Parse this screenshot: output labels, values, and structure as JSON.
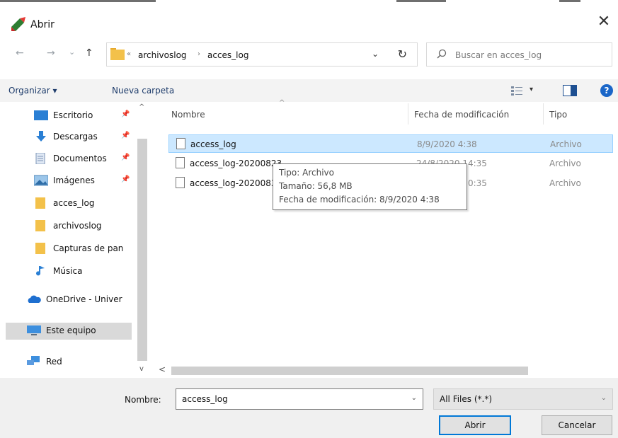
{
  "window": {
    "title": "Abrir"
  },
  "nav_buttons": {
    "back": "←",
    "forward": "→",
    "recent": "⌄",
    "up": "↑"
  },
  "address": {
    "overflow": "«",
    "crumbs": [
      "archivoslog",
      "acces_log"
    ],
    "separator": "›",
    "dropdown": "⌄",
    "refresh": "↻"
  },
  "search": {
    "placeholder": "Buscar en acces_log"
  },
  "toolbar": {
    "organize": "Organizar ▾",
    "new_folder": "Nueva carpeta",
    "view_dropdown": "▾",
    "help": "?"
  },
  "nav_pane": {
    "items": [
      {
        "label": "Escritorio",
        "icon": "desktop-icon",
        "pin": "📌"
      },
      {
        "label": "Descargas",
        "icon": "download-icon",
        "pin": "📌"
      },
      {
        "label": "Documentos",
        "icon": "document-icon",
        "pin": "📌"
      },
      {
        "label": "Imágenes",
        "icon": "pictures-icon",
        "pin": "📌"
      },
      {
        "label": "acces_log",
        "icon": "folder-icon"
      },
      {
        "label": "archivoslog",
        "icon": "folder-icon"
      },
      {
        "label": "Capturas de pan",
        "icon": "folder-icon"
      },
      {
        "label": "Música",
        "icon": "music-icon"
      },
      {
        "label": "OneDrive - Univer",
        "icon": "cloud-icon"
      },
      {
        "label": "Este equipo",
        "icon": "computer-icon",
        "selected": true
      },
      {
        "label": "Red",
        "icon": "network-icon"
      }
    ]
  },
  "columns": {
    "name": "Nombre",
    "date": "Fecha de modificación",
    "type": "Tipo"
  },
  "files": [
    {
      "name": "access_log",
      "date": "8/9/2020 4:38",
      "type": "Archivo",
      "selected": true
    },
    {
      "name": "access_log-20200823",
      "date": "24/8/2020 14:35",
      "type": "Archivo"
    },
    {
      "name": "access_log-20200830",
      "date": "31/8/2020 10:35",
      "type": "Archivo"
    }
  ],
  "tooltip": {
    "type": "Tipo: Archivo",
    "size": "Tamaño: 56,8 MB",
    "modified": "Fecha de modificación: 8/9/2020 4:38"
  },
  "scroll": {
    "up": "^",
    "down": "v",
    "left": "<"
  },
  "footer": {
    "name_label": "Nombre:",
    "name_value": "access_log",
    "name_dropdown": "⌄",
    "file_type": "All Files (*.*)",
    "type_dropdown": "⌄",
    "open": "Abrir",
    "cancel": "Cancelar"
  },
  "colors": {
    "accent": "#0078d7",
    "selection": "#cce8ff",
    "folder": "#f3c14a"
  }
}
